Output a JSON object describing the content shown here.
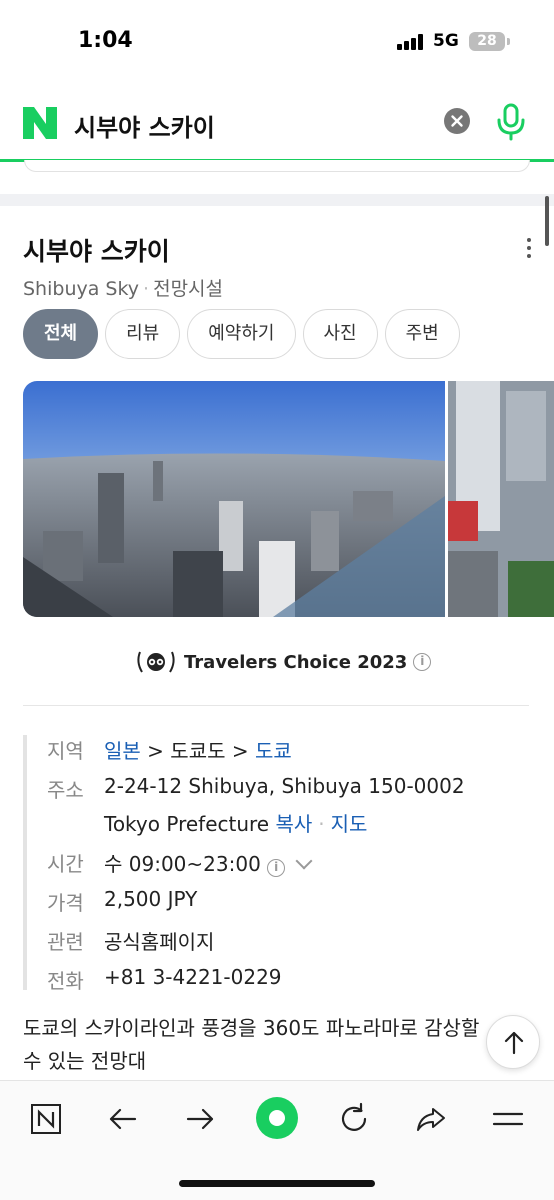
{
  "status_bar": {
    "time": "1:04",
    "network": "5G",
    "battery": "28"
  },
  "search": {
    "query": "시부야 스카이",
    "brand_color": "#19ce60"
  },
  "place": {
    "title": "시부야 스카이",
    "name_en": "Shibuya Sky",
    "category": "전망시설",
    "tabs": [
      {
        "label": "전체",
        "active": true
      },
      {
        "label": "리뷰",
        "active": false
      },
      {
        "label": "예약하기",
        "active": false
      },
      {
        "label": "사진",
        "active": false
      },
      {
        "label": "주변",
        "active": false
      }
    ],
    "award": "Travelers Choice 2023",
    "info": {
      "region": {
        "key": "지역",
        "country": "일본",
        "sep1": ">",
        "prefecture": "도쿄도",
        "sep2": ">",
        "city": "도쿄"
      },
      "address": {
        "key": "주소",
        "line1": "2-24-12 Shibuya, Shibuya 150-0002",
        "line2": "Tokyo Prefecture",
        "copy": "복사",
        "map": "지도"
      },
      "hours": {
        "key": "시간",
        "value": "수 09:00~23:00"
      },
      "price": {
        "key": "가격",
        "value": "2,500 JPY"
      },
      "related": {
        "key": "관련",
        "value": "공식홈페이지"
      },
      "phone": {
        "key": "전화",
        "value": "+81 3-4221-0229"
      }
    },
    "description": "도쿄의 스카이라인과 풍경을 360도 파노라마로 감상할 수 있는 전망대"
  },
  "toolbar": {
    "items": [
      "naver-home-icon",
      "back-arrow-icon",
      "forward-arrow-icon",
      "green-dot-icon",
      "refresh-icon",
      "share-icon",
      "menu-icon"
    ]
  }
}
